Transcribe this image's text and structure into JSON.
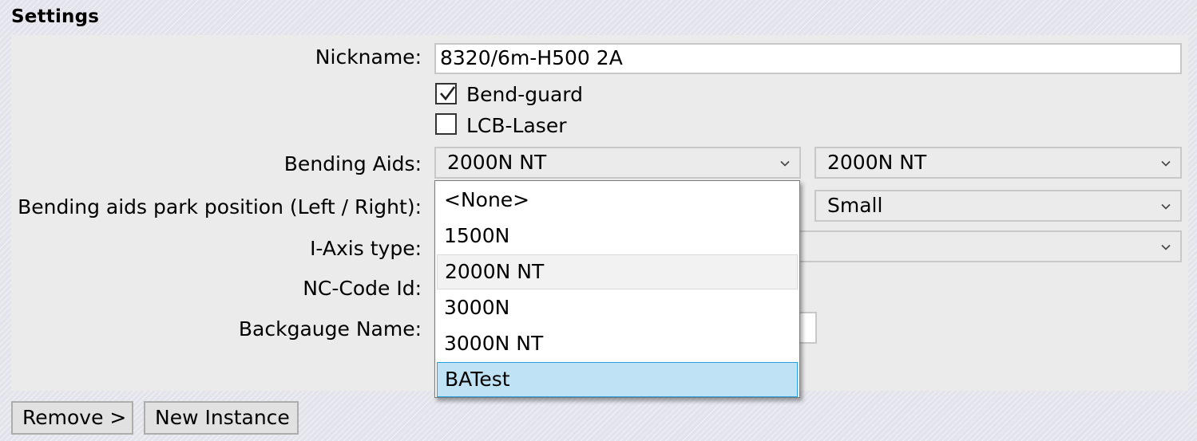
{
  "section_title": "Settings",
  "fields": {
    "nickname_label": "Nickname:",
    "nickname_value": "8320/6m-H500 2A",
    "bend_guard_label": "Bend-guard",
    "bend_guard_checked": true,
    "lcb_laser_label": "LCB-Laser",
    "lcb_laser_checked": false,
    "bending_aids_label": "Bending Aids:",
    "bending_aids_left": "2000N NT",
    "bending_aids_right": "2000N NT",
    "park_position_label": "Bending aids park position (Left / Right):",
    "park_position_right": "Small",
    "i_axis_label": "I-Axis type:",
    "nc_code_label": "NC-Code Id:",
    "backgauge_label": "Backgauge Name:"
  },
  "dropdown": {
    "options": [
      "<None>",
      "1500N",
      "2000N NT",
      "3000N",
      "3000N NT",
      "BATest"
    ],
    "hovered": "2000N NT",
    "highlighted": "BATest"
  },
  "buttons": {
    "remove": "Remove >",
    "new_instance": "New Instance"
  },
  "colors": {
    "highlight_fill": "#bfe3f4",
    "highlight_border": "#26a0da",
    "panel_bg": "#ebebeb"
  }
}
